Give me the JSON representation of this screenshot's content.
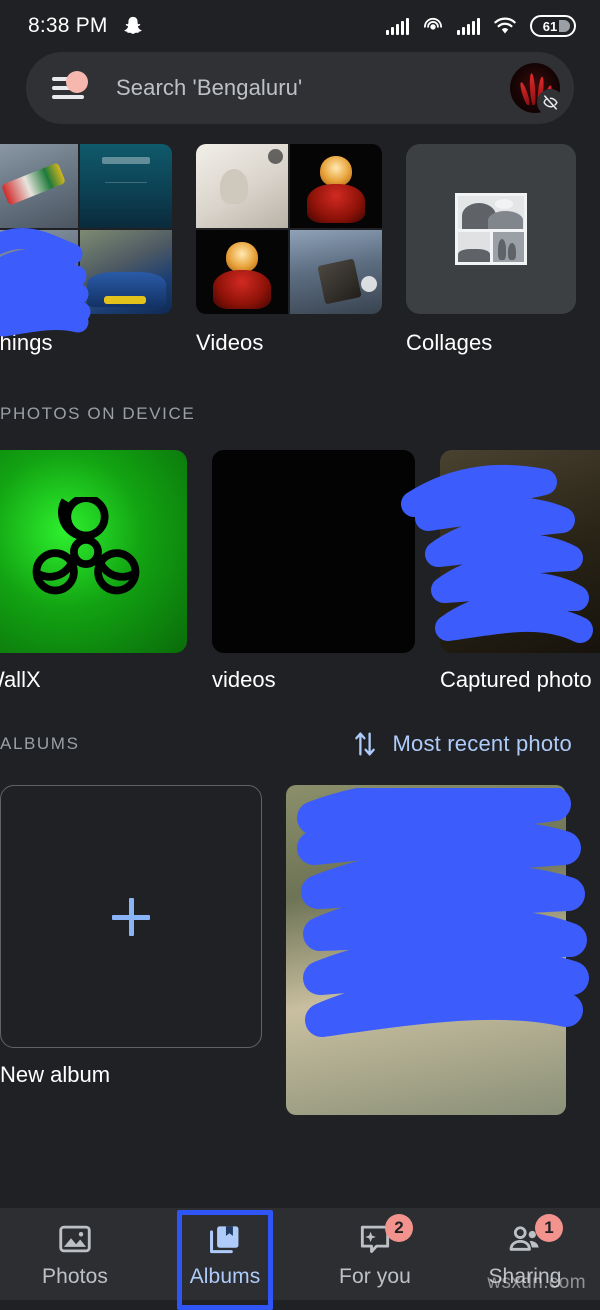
{
  "status_bar": {
    "time": "8:38 PM",
    "app_icon": "snapchat-ghost-icon",
    "battery_level": "61",
    "icons": [
      "signal-bars-icon",
      "hotspot-icon",
      "signal-bars-icon",
      "wifi-icon",
      "battery-icon"
    ]
  },
  "search": {
    "placeholder": "Search 'Bengaluru'",
    "menu_icon": "hamburger-menu-icon",
    "has_menu_notification_dot": true,
    "avatar_badge_icon": "eye-off-icon"
  },
  "categories": [
    {
      "label": "Things",
      "type": "photo-grid"
    },
    {
      "label": "Videos",
      "type": "photo-grid"
    },
    {
      "label": "Collages",
      "type": "placeholder"
    }
  ],
  "photos_on_device": {
    "header": "PHOTOS ON DEVICE",
    "items": [
      {
        "label": "WallX"
      },
      {
        "label": "videos"
      },
      {
        "label": "Captured photo"
      }
    ]
  },
  "albums": {
    "header": "ALBUMS",
    "sort": {
      "icon": "sort-arrows-icon",
      "label": "Most recent photo"
    },
    "new_album_label": "New album",
    "new_album_icon": "plus-icon",
    "items": [
      {
        "label": ""
      }
    ]
  },
  "bottom_nav": {
    "items": [
      {
        "label": "Photos",
        "icon": "photo-icon",
        "badge": "",
        "active": false
      },
      {
        "label": "Albums",
        "icon": "albums-icon",
        "badge": "",
        "active": true
      },
      {
        "label": "For you",
        "icon": "for-you-icon",
        "badge": "2",
        "active": false
      },
      {
        "label": "Sharing",
        "icon": "sharing-icon",
        "badge": "1",
        "active": false
      }
    ],
    "highlight_color": "#2f55f7"
  },
  "watermark": "wsxdn.com",
  "colors": {
    "background": "#202124",
    "surface": "#303134",
    "accent_blue": "#aecbfa",
    "redaction_blue": "#3d5cfc",
    "badge_salmon": "#f2938d"
  }
}
